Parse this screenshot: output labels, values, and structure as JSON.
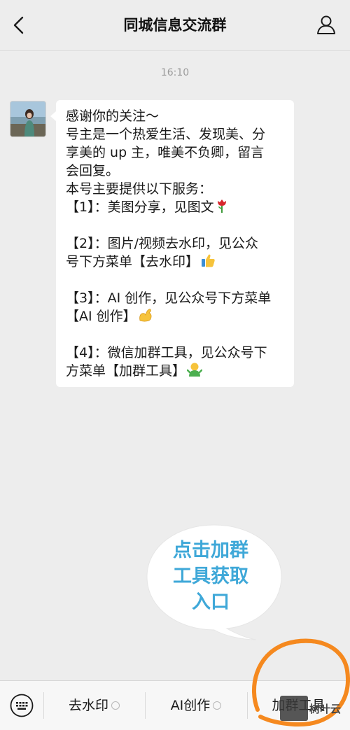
{
  "header": {
    "back_icon": "chevron-left-icon",
    "title": "同城信息交流群",
    "profile_icon": "user-icon"
  },
  "chat": {
    "timestamp": "16:10",
    "message": {
      "avatar": "avatar",
      "lines": [
        "感谢你的关注～",
        "号主是一个热爱生活、发现美、分",
        "享美的 up 主，唯美不负卿，留言",
        "会回复。",
        "本号主要提供以下服务：",
        "【1】：美图分享，见图文",
        "",
        "【2】：图片/视频去水印，见公众",
        "号下方菜单【去水印】",
        "",
        "【3】：AI 创作，见公众号下方菜单",
        "【AI 创作】",
        "",
        "【4】：微信加群工具，见公众号下",
        "方菜单【加群工具】"
      ],
      "emojis": {
        "line5": "rose-emoji",
        "line8": "thumbs-up-emoji",
        "line11": "flexed-biceps-emoji",
        "line14": "person-emoji"
      }
    }
  },
  "annotation": {
    "callout_text": "点击加群工具获取入口",
    "callout_lines": [
      "点击加群",
      "工具获取",
      "入口"
    ],
    "callout_color": "#3fa8d8",
    "circle_color": "#f5891f"
  },
  "bottom_menu": {
    "keyboard_icon": "keyboard-icon",
    "items": [
      {
        "label": "去水印"
      },
      {
        "label": "AI创作"
      },
      {
        "label": "加群工具"
      }
    ]
  },
  "watermark": {
    "text": "树叶云"
  }
}
